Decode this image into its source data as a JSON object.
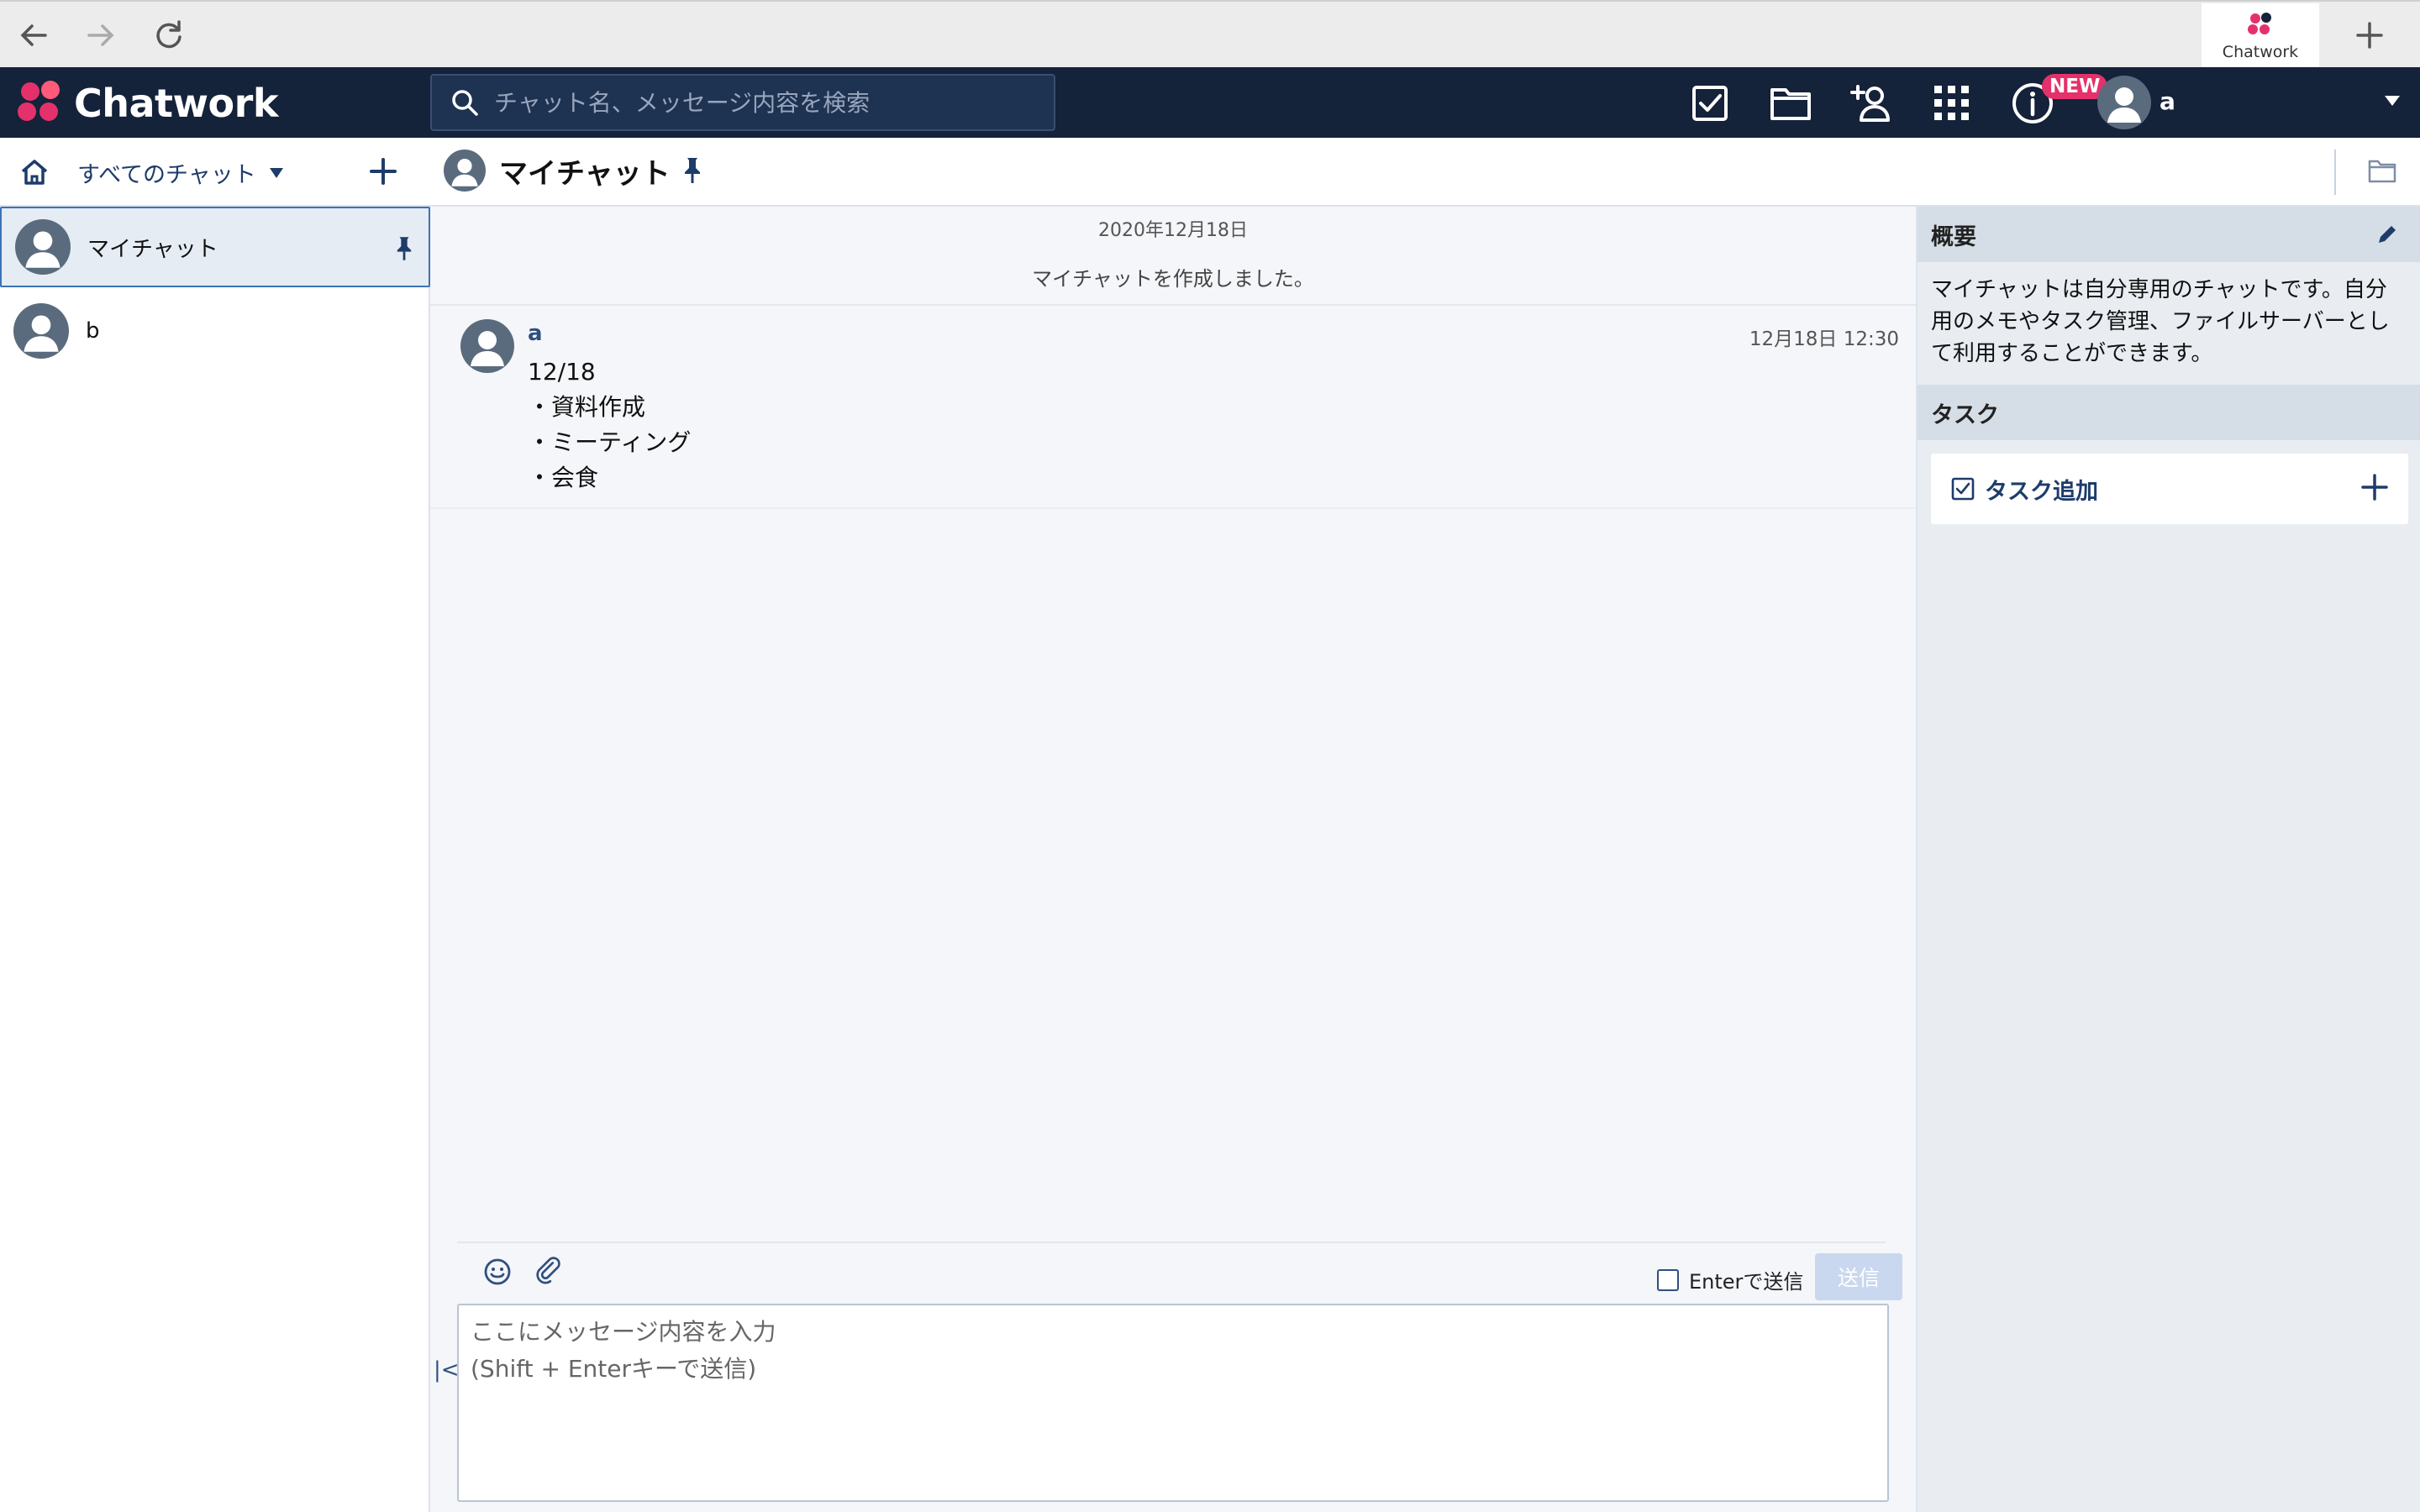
{
  "browser": {
    "tab_title": "Chatwork",
    "icons": [
      "back-arrow-icon",
      "forward-arrow-icon",
      "reload-icon",
      "new-tab-plus-icon"
    ]
  },
  "header": {
    "brand": "Chatwork",
    "search_placeholder": "チャット名、メッセージ内容を検索",
    "new_badge": "NEW",
    "user_name": "a",
    "icons": [
      "task-check-icon",
      "folder-icon",
      "add-contact-icon",
      "apps-grid-icon",
      "info-icon"
    ],
    "colors": {
      "header_bg": "#14223a",
      "accent": "#e5316b"
    }
  },
  "subheader": {
    "filter_label": "すべてのチャット",
    "room_title": "マイチャット"
  },
  "sidebar": {
    "rooms": [
      {
        "label": "マイチャット",
        "active": true,
        "pinned": true
      },
      {
        "label": "b",
        "active": false,
        "pinned": false
      }
    ]
  },
  "timeline": {
    "date": "2020年12月18日",
    "system_message": "マイチャットを作成しました。",
    "messages": [
      {
        "author": "a",
        "time": "12月18日 12:30",
        "lines": [
          "12/18",
          "・資料作成",
          "・ミーティング",
          "・会食"
        ]
      }
    ]
  },
  "composer": {
    "enter_send_label": "Enterで送信",
    "enter_send_checked": false,
    "send_label": "送信",
    "placeholder": "ここにメッセージ内容を入力\n(Shift + Enterキーで送信)"
  },
  "right_panel": {
    "overview_heading": "概要",
    "overview_text": "マイチャットは自分専用のチャットです。自分用のメモやタスク管理、ファイルサーバーとして利用することができます。",
    "task_heading": "タスク",
    "task_add_label": "タスク追加"
  }
}
